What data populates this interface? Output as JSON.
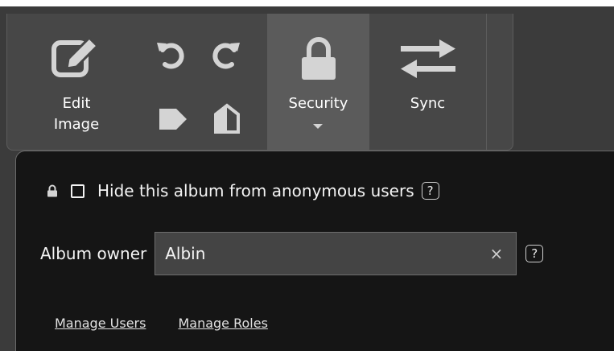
{
  "toolbar": {
    "edit_image": {
      "label_line1": "Edit",
      "label_line2": "Image",
      "icon": "edit-image-icon"
    },
    "rotate_left": {
      "icon": "rotate-left-icon"
    },
    "rotate_right": {
      "icon": "rotate-right-icon"
    },
    "tag": {
      "icon": "tag-icon"
    },
    "contrast": {
      "icon": "contrast-icon"
    },
    "security": {
      "label": "Security",
      "icon": "lock-icon",
      "dropdown_icon": "caret-down-icon",
      "active": true
    },
    "sync": {
      "label": "Sync",
      "icon": "sync-arrows-icon"
    }
  },
  "security_panel": {
    "hide_album": {
      "label": "Hide this album from anonymous users",
      "checked": false,
      "help": "?"
    },
    "album_owner": {
      "label": "Album owner",
      "value": "Albin",
      "clear": "×",
      "help": "?"
    },
    "links": {
      "manage_users": "Manage Users",
      "manage_roles": "Manage Roles"
    }
  },
  "colors": {
    "toolbar_bg": "#474747",
    "active_tab": "#5b5b5b",
    "panel_bg": "#151515",
    "input_bg": "#444444",
    "icon_color": "#d4d4d4"
  }
}
